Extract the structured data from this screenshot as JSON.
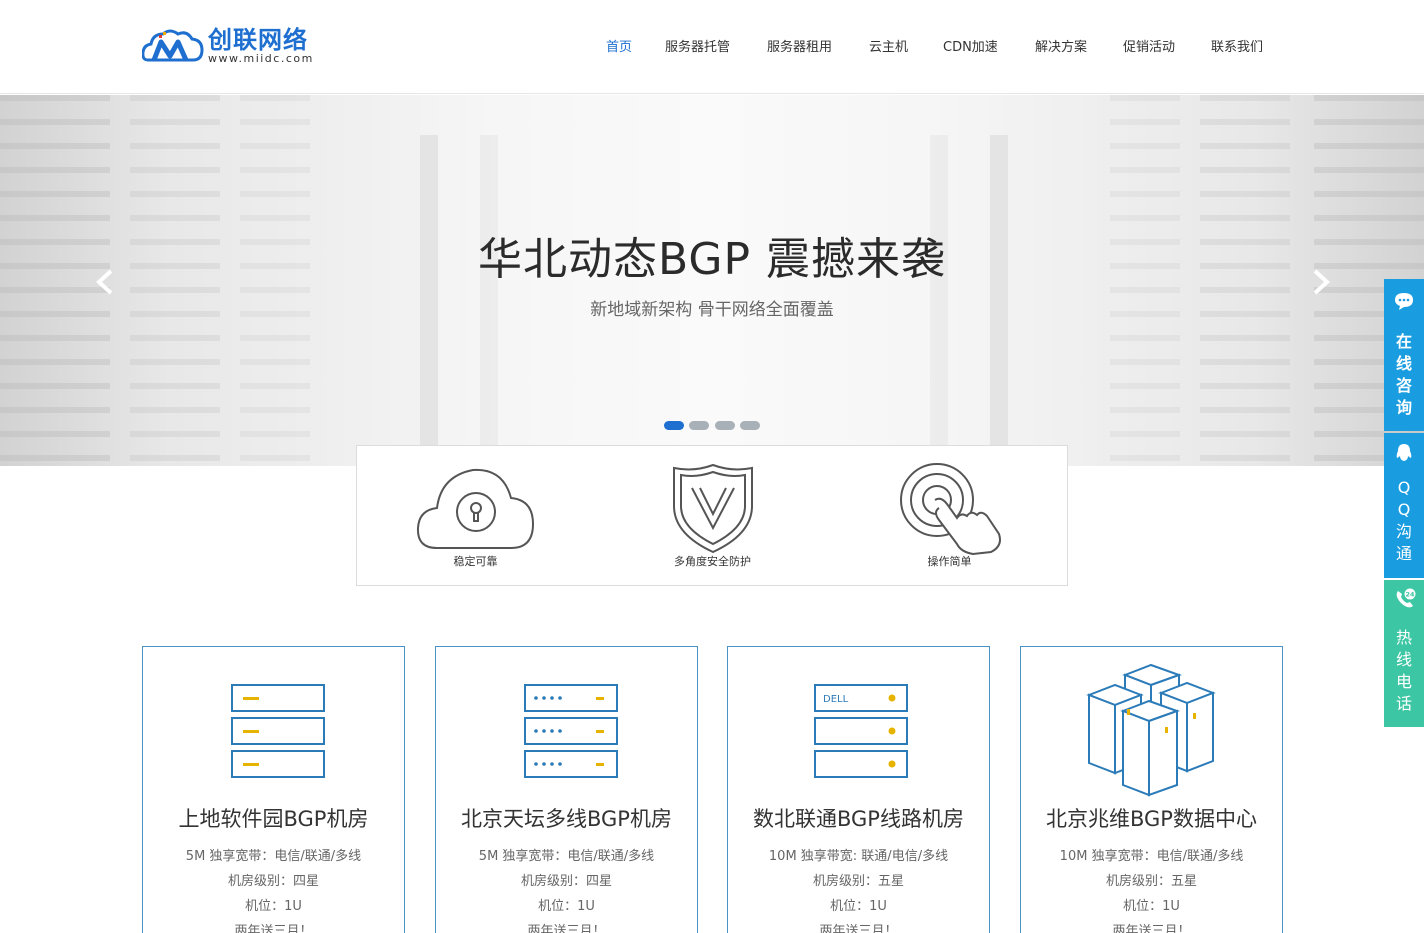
{
  "header": {
    "logo": {
      "name": "创联网络",
      "url": "www.miidc.com"
    },
    "nav": [
      {
        "label": "首页",
        "active": true
      },
      {
        "label": "服务器托管"
      },
      {
        "label": "服务器租用"
      },
      {
        "label": "云主机"
      },
      {
        "label": "CDN加速"
      },
      {
        "label": "解决方案"
      },
      {
        "label": "促销活动"
      },
      {
        "label": "联系我们"
      }
    ]
  },
  "banner": {
    "title": "华北动态BGP 震撼来袭",
    "subtitle": "新地域新架构  骨干网络全面覆盖",
    "slide_count": 4,
    "active_slide": 0
  },
  "features": [
    {
      "label": "稳定可靠",
      "icon": "cloud-lock-icon"
    },
    {
      "label": "多角度安全防护",
      "icon": "shield-icon"
    },
    {
      "label": "操作简单",
      "icon": "touch-hand-icon"
    }
  ],
  "cards": [
    {
      "title": "上地软件园BGP机房",
      "lines": [
        "5M 独享宽带：电信/联通/多线",
        "机房级别：四星",
        "机位：1U",
        "两年送三月！"
      ],
      "icon": "server-stack-icon"
    },
    {
      "title": "北京天坛多线BGP机房",
      "lines": [
        "5M 独享宽带：电信/联通/多线",
        "机房级别：四星",
        "机位：1U",
        "两年送三月！"
      ],
      "icon": "server-rack-icon"
    },
    {
      "title": "数北联通BGP线路机房",
      "lines": [
        "10M 独享带宽: 联通/电信/多线",
        "机房级别：五星",
        "机位：1U",
        "两年送三月！"
      ],
      "icon": "dell-server-icon",
      "brand": "DELL"
    },
    {
      "title": "北京兆维BGP数据中心",
      "lines": [
        "10M 独享宽带：电信/联通/多线",
        "机房级别：五星",
        "机位：1U",
        "两年送三月！"
      ],
      "icon": "data-center-cubes-icon"
    }
  ],
  "side": {
    "consult": "在线咨询",
    "qq": "QQ沟通",
    "hotline": "热线电话",
    "hotline_badge": "24"
  },
  "colors": {
    "brand": "#1e6fd0",
    "side_blue": "#1a9de0",
    "side_green": "#3cc6a3",
    "card_border": "#4a93c5",
    "accent_yellow": "#e6b400"
  }
}
